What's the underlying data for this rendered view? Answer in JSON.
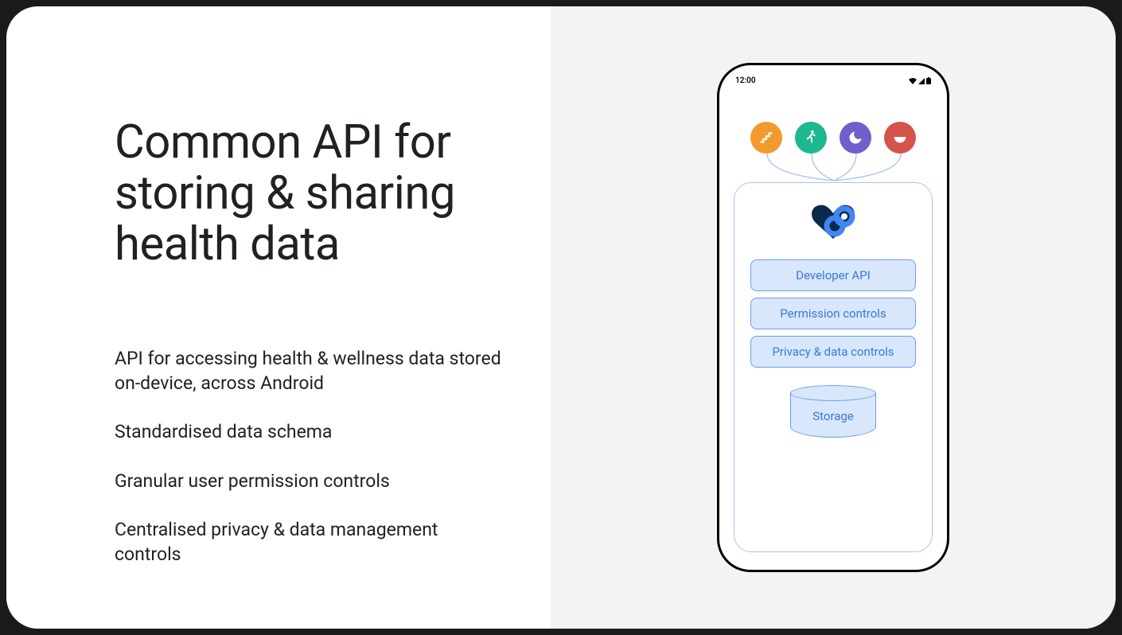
{
  "title": "Common API for storing & sharing health data",
  "bullets": [
    "API for accessing health & wellness data stored on-device, across Android",
    "Standardised data schema",
    "Granular user permission controls",
    "Centralised privacy & data management controls"
  ],
  "phone": {
    "time": "12:00",
    "apps": [
      {
        "name": "stairs-icon",
        "color": "#f29a2e"
      },
      {
        "name": "runner-icon",
        "color": "#1db88f"
      },
      {
        "name": "moon-icon",
        "color": "#6e5fca"
      },
      {
        "name": "bowl-icon",
        "color": "#d45449"
      }
    ],
    "pills": [
      "Developer API",
      "Permission controls",
      "Privacy & data controls"
    ],
    "storage_label": "Storage"
  }
}
